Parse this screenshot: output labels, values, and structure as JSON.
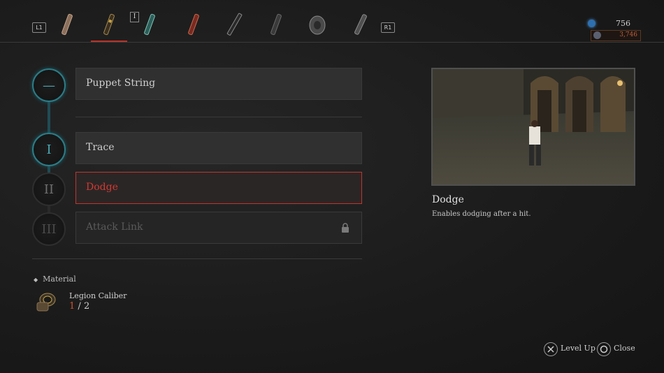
{
  "topbar": {
    "left_shoulder": "L1",
    "right_shoulder": "R1",
    "badge": "I",
    "tabs": [
      {
        "icon": "handle-icon"
      },
      {
        "icon": "puppet-string-handle-icon"
      },
      {
        "icon": "teal-handle-icon"
      },
      {
        "icon": "red-handle-icon"
      },
      {
        "icon": "rifle-handle-icon"
      },
      {
        "icon": "dark-handle-icon"
      },
      {
        "icon": "round-handle-icon"
      },
      {
        "icon": "grey-handle-icon"
      }
    ],
    "currency_primary": "756",
    "currency_secondary": "3,746"
  },
  "skills": {
    "base": {
      "label": "Puppet String",
      "node": "—"
    },
    "tier1": {
      "label": "Trace",
      "node": "I"
    },
    "tier2": {
      "label": "Dodge",
      "node": "II"
    },
    "tier3": {
      "label": "Attack Link",
      "node": "III"
    }
  },
  "material": {
    "header": "Material",
    "name": "Legion Caliber",
    "have": "1",
    "separator": "/",
    "need": "2"
  },
  "detail": {
    "title": "Dodge",
    "description": "Enables dodging after a hit."
  },
  "prompts": {
    "level_up": "Level Up",
    "close": "Close"
  },
  "colors": {
    "accent_red": "#c4332b",
    "node_teal": "#2c7d88",
    "material_have": "#d2522d"
  }
}
